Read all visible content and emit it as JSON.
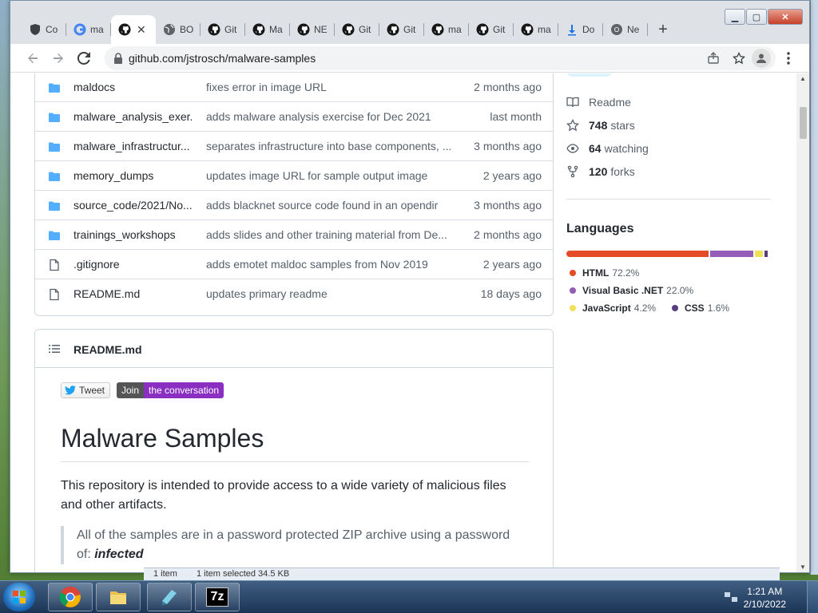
{
  "browser": {
    "tabs": [
      {
        "icon": "shield-icon",
        "title": "Co"
      },
      {
        "icon": "google-icon",
        "title": "ma"
      },
      {
        "icon": "github-icon",
        "title": "",
        "active": true
      },
      {
        "icon": "globe-icon",
        "title": "BO"
      },
      {
        "icon": "github-icon",
        "title": "Git"
      },
      {
        "icon": "github-icon",
        "title": "Ma"
      },
      {
        "icon": "github-icon",
        "title": "NE"
      },
      {
        "icon": "github-icon",
        "title": "Git"
      },
      {
        "icon": "github-icon",
        "title": "Git"
      },
      {
        "icon": "github-icon",
        "title": "ma"
      },
      {
        "icon": "github-icon",
        "title": "Git"
      },
      {
        "icon": "github-icon",
        "title": "ma"
      },
      {
        "icon": "download-icon",
        "title": "Do"
      },
      {
        "icon": "chrome-icon",
        "title": "Ne"
      }
    ],
    "new_tab_label": "+",
    "url": "github.com/jstrosch/malware-samples"
  },
  "files": [
    {
      "type": "folder",
      "name": "maldocs",
      "message": "fixes error in image URL",
      "age": "2 months ago"
    },
    {
      "type": "folder",
      "name": "malware_analysis_exer...",
      "message": "adds malware analysis exercise for Dec 2021",
      "age": "last month"
    },
    {
      "type": "folder",
      "name": "malware_infrastructur...",
      "message": "separates infrastructure into base components, ...",
      "age": "3 months ago"
    },
    {
      "type": "folder",
      "name": "memory_dumps",
      "message": "updates image URL for sample output image",
      "age": "2 years ago"
    },
    {
      "type": "folder",
      "name": "source_code/2021/No...",
      "message": "adds blacknet source code found in an opendir",
      "age": "3 months ago"
    },
    {
      "type": "folder",
      "name": "trainings_workshops",
      "message": "adds slides and other training material from De...",
      "age": "2 months ago"
    },
    {
      "type": "file",
      "name": ".gitignore",
      "message": "adds emotet maldoc samples from Nov 2019",
      "age": "2 years ago"
    },
    {
      "type": "file",
      "name": "README.md",
      "message": "updates primary readme",
      "age": "18 days ago"
    }
  ],
  "readme": {
    "header": "README.md",
    "badge_tweet": "Tweet",
    "badge_join_left": "Join",
    "badge_join_right": "the conversation",
    "title": "Malware Samples",
    "paragraph": "This repository is intended to provide access to a wide variety of malicious files and other artifacts.",
    "quote_text": "All of the samples are in a password protected ZIP archive using a password of: ",
    "quote_password": "infected"
  },
  "sidebar": {
    "readme_label": "Readme",
    "stars_count": "748",
    "stars_label": "stars",
    "watching_count": "64",
    "watching_label": "watching",
    "forks_count": "120",
    "forks_label": "forks",
    "languages_title": "Languages",
    "languages": [
      {
        "name": "HTML",
        "percent": "72.2%",
        "value": 72.2,
        "color": "#e34c26"
      },
      {
        "name": "Visual Basic .NET",
        "percent": "22.0%",
        "value": 22.0,
        "color": "#945db7"
      },
      {
        "name": "JavaScript",
        "percent": "4.2%",
        "value": 4.2,
        "color": "#f1e05a"
      },
      {
        "name": "CSS",
        "percent": "1.6%",
        "value": 1.6,
        "color": "#563d7c"
      }
    ]
  },
  "explorer": {
    "items": "1 item",
    "selected": "1 item selected  34.5 KB"
  },
  "taskbar": {
    "time": "1:21 AM",
    "date": "2/10/2022",
    "apps": [
      "chrome-icon",
      "folder-icon",
      "notepad-icon",
      "7zip-icon"
    ],
    "sevenzip_label": "7z"
  }
}
